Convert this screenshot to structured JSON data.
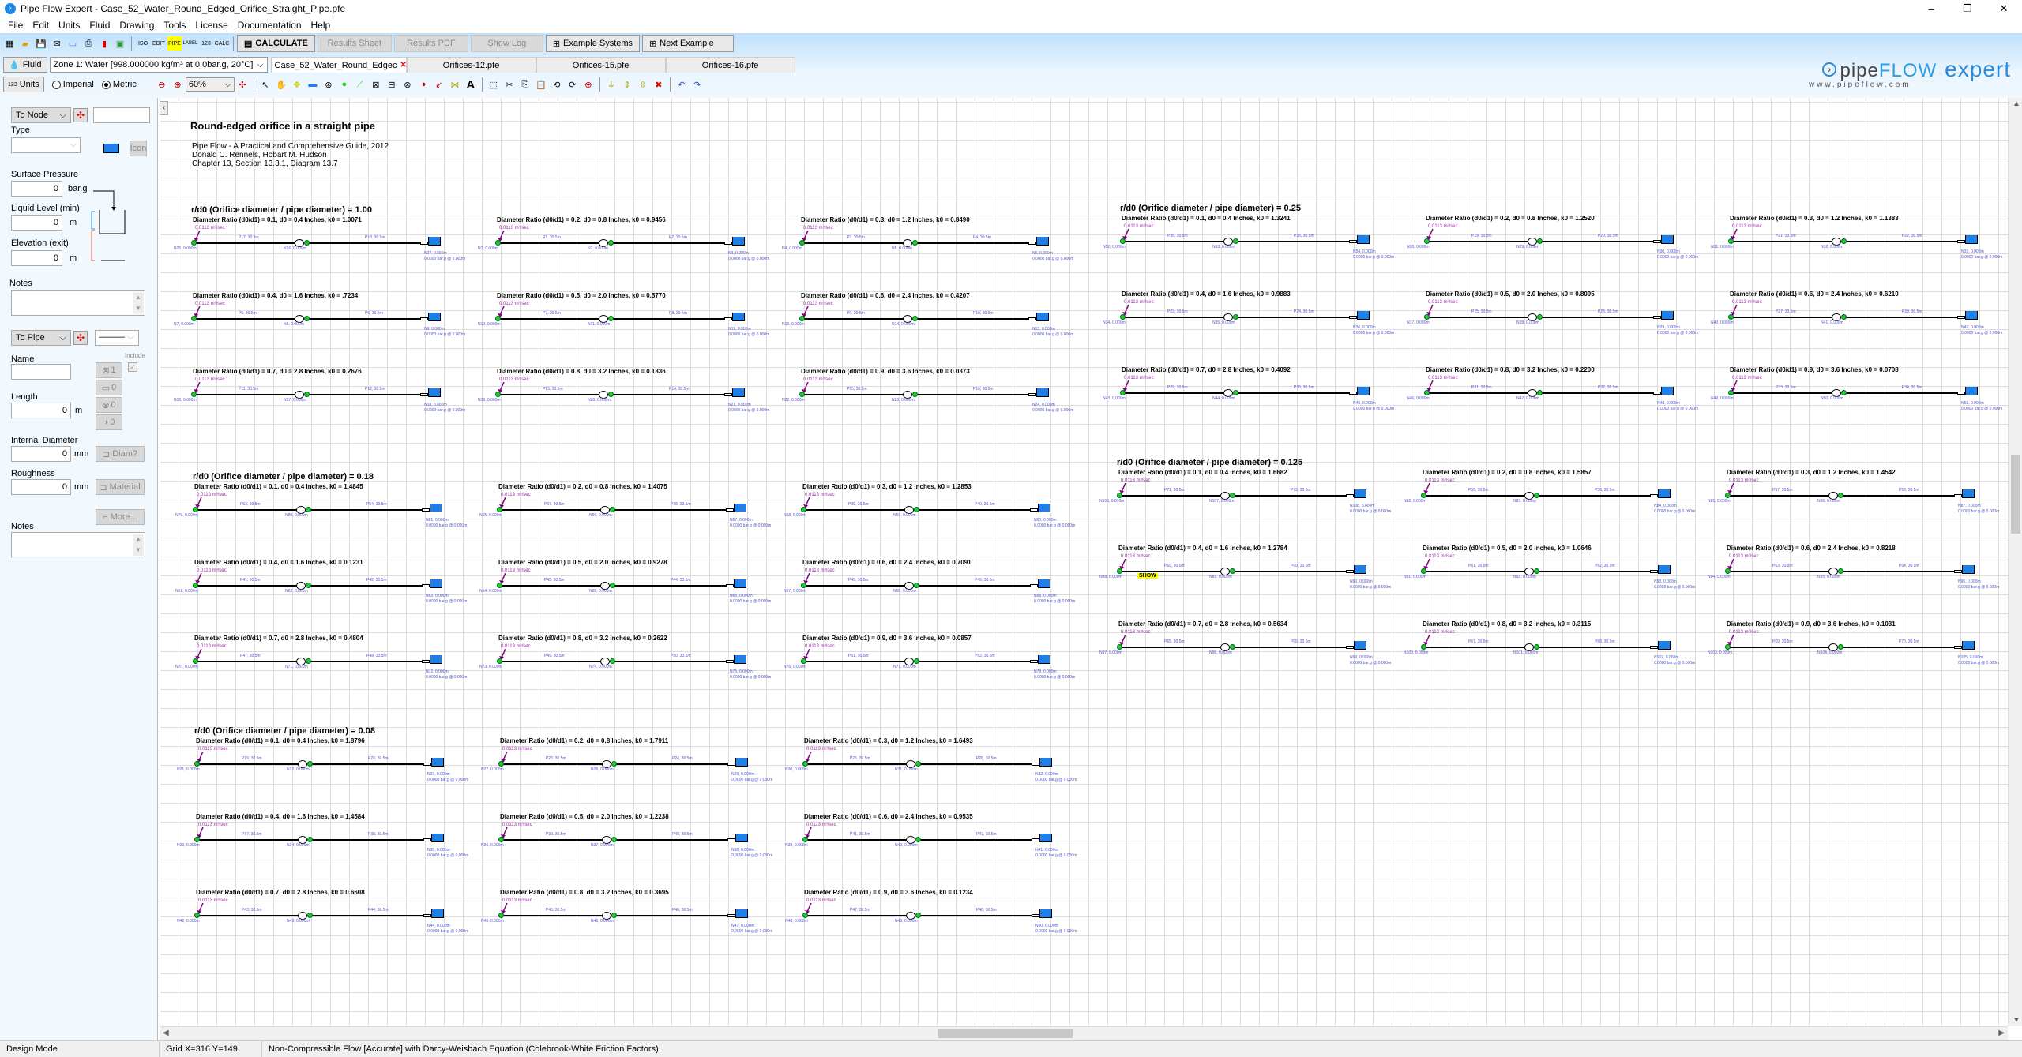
{
  "window": {
    "title": "Pipe Flow Expert - Case_52_Water_Round_Edged_Orifice_Straight_Pipe.pfe",
    "minimize": "–",
    "maximize": "❐",
    "close": "✕"
  },
  "menu": [
    "File",
    "Edit",
    "Units",
    "Fluid",
    "Drawing",
    "Tools",
    "License",
    "Documentation",
    "Help"
  ],
  "toolbar": {
    "icons_left": [
      "new-grid-icon",
      "open-folder-icon",
      "save-icon",
      "email-icon",
      "export-icon",
      "print-icon",
      "pdf-icon",
      "image-icon"
    ],
    "icons_mid": [
      "ISO",
      "EDIT",
      "PIPE",
      "LABEL",
      "123",
      "CALC"
    ],
    "calculate": "CALCULATE",
    "results_sheet": "Results Sheet",
    "results_pdf": "Results PDF",
    "show_log": "Show Log",
    "example_systems": "Example Systems",
    "next_example": "Next Example"
  },
  "fluid": {
    "button": "Fluid",
    "zone": "Zone 1: Water [998.000000 kg/m³ at 0.0bar.g, 20°C]"
  },
  "tabs": [
    {
      "label": "Case_52_Water_Round_Edgec",
      "active": true
    },
    {
      "label": "Orifices-12.pfe",
      "active": false
    },
    {
      "label": "Orifices-15.pfe",
      "active": false
    },
    {
      "label": "Orifices-16.pfe",
      "active": false
    }
  ],
  "units": {
    "button": "Units",
    "imperial": "Imperial",
    "metric": "Metric",
    "selected": "Metric"
  },
  "zoom_level": "60%",
  "logo": {
    "pipe": "pipe",
    "flow": "FLOW",
    "expert": "expert",
    "url": "www.pipeflow.com"
  },
  "node_panel": {
    "to_node": "To Node",
    "node_name": "",
    "type_label": "Type",
    "type_value": "",
    "icon_button": "Icon",
    "surface_pressure_label": "Surface Pressure",
    "surface_pressure": "0",
    "surface_pressure_unit": "bar.g",
    "liquid_level_label": "Liquid Level (min)",
    "liquid_level": "0",
    "liquid_level_unit": "m",
    "elevation_label": "Elevation (exit)",
    "elevation": "0",
    "elevation_unit": "m",
    "notes_label": "Notes"
  },
  "pipe_panel": {
    "to_pipe": "To Pipe",
    "name_label": "Name",
    "name": "",
    "include_label": "Include",
    "fittings_count": "1",
    "component_count": "0",
    "valve_count": "0",
    "pump_count": "0",
    "length_label": "Length",
    "length": "0",
    "length_unit": "m",
    "diameter_label": "Internal Diameter",
    "diameter": "0",
    "diameter_unit": "mm",
    "diam_button": "Diam?",
    "roughness_label": "Roughness",
    "roughness": "0",
    "roughness_unit": "mm",
    "material_button": "Material",
    "more_button": "More...",
    "notes_label": "Notes"
  },
  "drawing": {
    "title": "Round-edged orifice in a straight pipe",
    "reference": [
      "Pipe Flow - A Practical and Comprehensive Guide, 2012",
      "Donald C. Rennels, Hobart M. Hudson",
      "Chapter 13, Section 13.3.1, Diagram 13.7"
    ],
    "flow_label": "0.0113 m³/sec",
    "pipe_length": "30.5m",
    "node_elev": "0.000m",
    "tank_pressure": "0.0000 bar.g @ 0.000m",
    "show_label": "SHOW",
    "sections": [
      {
        "heading": "r/d0 (Orifice diameter / pipe diameter) = 1.00",
        "items": [
          {
            "caption": "Diameter Ratio (d0/d1) = 0.1, d0 = 0.4 Inches, k0 = 1.0071",
            "p1": "P17",
            "p2": "P18",
            "n1": "N25",
            "n2": "N26",
            "n3": "N27"
          },
          {
            "caption": "Diameter Ratio (d0/d1) = 0.2, d0 = 0.8 Inches, k0 = 0.9456",
            "p1": "P1",
            "p2": "P2",
            "n1": "N1",
            "n2": "N2",
            "n3": "N3"
          },
          {
            "caption": "Diameter Ratio (d0/d1) = 0.3, d0 = 1.2 Inches, k0 = 0.8490",
            "p1": "P3",
            "p2": "P4",
            "n1": "N4",
            "n2": "N5",
            "n3": "N6"
          },
          {
            "caption": "Diameter Ratio (d0/d1) = 0.4, d0 = 1.6 Inches, k0 = .7234",
            "p1": "P5",
            "p2": "P6",
            "n1": "N7",
            "n2": "N8",
            "n3": "N9"
          },
          {
            "caption": "Diameter Ratio (d0/d1) = 0.5, d0 = 2.0 Inches, k0 = 0.5770",
            "p1": "P7",
            "p2": "P8",
            "n1": "N10",
            "n2": "N11",
            "n3": "N12"
          },
          {
            "caption": "Diameter Ratio (d0/d1) = 0.6, d0 = 2.4 Inches, k0 = 0.4207",
            "p1": "P9",
            "p2": "P10",
            "n1": "N13",
            "n2": "N14",
            "n3": "N15"
          },
          {
            "caption": "Diameter Ratio (d0/d1) = 0.7, d0 = 2.8 Inches, k0 = 0.2676",
            "p1": "P11",
            "p2": "P12",
            "n1": "N16",
            "n2": "N17",
            "n3": "N18"
          },
          {
            "caption": "Diameter Ratio (d0/d1) = 0.8, d0 = 3.2 Inches, k0 = 0.1336",
            "p1": "P13",
            "p2": "P14",
            "n1": "N19",
            "n2": "N20",
            "n3": "N21"
          },
          {
            "caption": "Diameter Ratio (d0/d1) = 0.9, d0 = 3.6 Inches, k0 = 0.0373",
            "p1": "P15",
            "p2": "P16",
            "n1": "N22",
            "n2": "N23",
            "n3": "N24"
          }
        ]
      },
      {
        "heading": "r/d0 (Orifice diameter / pipe diameter) = 0.25",
        "items": [
          {
            "caption": "Diameter Ratio (d0/d1) = 0.1, d0 = 0.4 Inches, k0 = 1.3241",
            "p1": "P35",
            "p2": "P36",
            "n1": "N52",
            "n2": "N53",
            "n3": "N54"
          },
          {
            "caption": "Diameter Ratio (d0/d1) = 0.2, d0 = 0.8 Inches, k0 = 1.2520",
            "p1": "P19",
            "p2": "P20",
            "n1": "N28",
            "n2": "N29",
            "n3": "N30"
          },
          {
            "caption": "Diameter Ratio (d0/d1) = 0.3, d0 = 1.2 Inches, k0 = 1.1383",
            "p1": "P21",
            "p2": "P22",
            "n1": "N31",
            "n2": "N32",
            "n3": "N33"
          },
          {
            "caption": "Diameter Ratio (d0/d1) = 0.4, d0 = 1.6 Inches, k0 = 0.9883",
            "p1": "P23",
            "p2": "P24",
            "n1": "N34",
            "n2": "N35",
            "n3": "N36"
          },
          {
            "caption": "Diameter Ratio (d0/d1) = 0.5, d0 = 2.0 Inches, k0 = 0.8095",
            "p1": "P25",
            "p2": "P26",
            "n1": "N37",
            "n2": "N38",
            "n3": "N39"
          },
          {
            "caption": "Diameter Ratio (d0/d1) = 0.6, d0 = 2.4 Inches, k0 = 0.6210",
            "p1": "P27",
            "p2": "P28",
            "n1": "N40",
            "n2": "N41",
            "n3": "N42"
          },
          {
            "caption": "Diameter Ratio (d0/d1) = 0.7, d0 = 2.8 Inches, k0 = 0.4092",
            "p1": "P29",
            "p2": "P30",
            "n1": "N43",
            "n2": "N44",
            "n3": "N45"
          },
          {
            "caption": "Diameter Ratio (d0/d1) = 0.8, d0 = 3.2 Inches, k0 = 0.2200",
            "p1": "P31",
            "p2": "P32",
            "n1": "N46",
            "n2": "N47",
            "n3": "N48"
          },
          {
            "caption": "Diameter Ratio (d0/d1) = 0.9, d0 = 3.6 Inches, k0 = 0.0708",
            "p1": "P33",
            "p2": "P34",
            "n1": "N49",
            "n2": "N50",
            "n3": "N51"
          }
        ]
      },
      {
        "heading": "r/d0 (Orifice diameter / pipe diameter) = 0.18",
        "items": [
          {
            "caption": "Diameter Ratio (d0/d1) = 0.1, d0 = 0.4 Inches, k0 = 1.4845",
            "p1": "P53",
            "p2": "P54",
            "n1": "N79",
            "n2": "N80",
            "n3": "N81"
          },
          {
            "caption": "Diameter Ratio (d0/d1) = 0.2, d0 = 0.8 Inches, k0 = 1.4075",
            "p1": "P37",
            "p2": "P38",
            "n1": "N55",
            "n2": "N56",
            "n3": "N57"
          },
          {
            "caption": "Diameter Ratio (d0/d1) = 0.3, d0 = 1.2 Inches, k0 = 1.2853",
            "p1": "P39",
            "p2": "P40",
            "n1": "N58",
            "n2": "N59",
            "n3": "N60"
          },
          {
            "caption": "Diameter Ratio (d0/d1) = 0.4, d0 = 1.6 Inches, k0 = 0.1231",
            "p1": "P41",
            "p2": "P42",
            "n1": "N61",
            "n2": "N62",
            "n3": "N63"
          },
          {
            "caption": "Diameter Ratio (d0/d1) = 0.5, d0 = 2.0 Inches, k0 = 0.9278",
            "p1": "P43",
            "p2": "P44",
            "n1": "N64",
            "n2": "N65",
            "n3": "N66"
          },
          {
            "caption": "Diameter Ratio (d0/d1) = 0.6, d0 = 2.4 Inches, k0 = 0.7091",
            "p1": "P45",
            "p2": "P46",
            "n1": "N67",
            "n2": "N68",
            "n3": "N69"
          },
          {
            "caption": "Diameter Ratio (d0/d1) = 0.7, d0 = 2.8 Inches, k0 = 0.4804",
            "p1": "P47",
            "p2": "P48",
            "n1": "N70",
            "n2": "N71",
            "n3": "N72"
          },
          {
            "caption": "Diameter Ratio (d0/d1) = 0.8, d0 = 3.2 Inches, k0 = 0.2622",
            "p1": "P49",
            "p2": "P50",
            "n1": "N73",
            "n2": "N74",
            "n3": "N75"
          },
          {
            "caption": "Diameter Ratio (d0/d1) = 0.9, d0 = 3.6 Inches, k0 = 0.0857",
            "p1": "P51",
            "p2": "P52",
            "n1": "N76",
            "n2": "N77",
            "n3": "N78"
          }
        ]
      },
      {
        "heading": "r/d0 (Orifice diameter / pipe diameter) = 0.125",
        "items": [
          {
            "caption": "Diameter Ratio (d0/d1) = 0.1, d0 = 0.4 Inches, k0 = 1.6682",
            "p1": "P71",
            "p2": "P72",
            "n1": "N106",
            "n2": "N107",
            "n3": "N108"
          },
          {
            "caption": "Diameter Ratio (d0/d1) = 0.2, d0 = 0.8 Inches, k0 = 1.5857",
            "p1": "P55",
            "p2": "P56",
            "n1": "N82",
            "n2": "N83",
            "n3": "N84"
          },
          {
            "caption": "Diameter Ratio (d0/d1) = 0.3, d0 = 1.2 Inches, k0 = 1.4542",
            "p1": "P57",
            "p2": "P58",
            "n1": "N85",
            "n2": "N86",
            "n3": "N87"
          },
          {
            "caption": "Diameter Ratio (d0/d1) = 0.4, d0 = 1.6 Inches, k0 = 1.2784",
            "p1": "P59",
            "p2": "P60",
            "n1": "N88",
            "n2": "N89",
            "n3": "N90",
            "show": true
          },
          {
            "caption": "Diameter Ratio (d0/d1) = 0.5, d0 = 2.0 Inches, k0 = 1.0646",
            "p1": "P61",
            "p2": "P62",
            "n1": "N91",
            "n2": "N92",
            "n3": "N93"
          },
          {
            "caption": "Diameter Ratio (d0/d1) = 0.6, d0 = 2.4 Inches, k0 = 0.8218",
            "p1": "P63",
            "p2": "P64",
            "n1": "N94",
            "n2": "N95",
            "n3": "N96"
          },
          {
            "caption": "Diameter Ratio (d0/d1) = 0.7, d0 = 2.8 Inches, k0 = 0.5634",
            "p1": "P65",
            "p2": "P66",
            "n1": "N97",
            "n2": "N98",
            "n3": "N99"
          },
          {
            "caption": "Diameter Ratio (d0/d1) = 0.8, d0 = 3.2 Inches, k0 = 0.3115",
            "p1": "P67",
            "p2": "P68",
            "n1": "N100",
            "n2": "N101",
            "n3": "N102"
          },
          {
            "caption": "Diameter Ratio (d0/d1) = 0.9, d0 = 3.6 Inches, k0 = 0.1031",
            "p1": "P69",
            "p2": "P70",
            "n1": "N103",
            "n2": "N104",
            "n3": "N105"
          }
        ]
      },
      {
        "heading": "r/d0 (Orifice diameter / pipe diameter) = 0.08",
        "items": [
          {
            "caption": "Diameter Ratio (d0/d1) = 0.1, d0 = 0.4 Inches, k0 = 1.8796",
            "p1": "P19",
            "p2": "P20",
            "n1": "N21",
            "n2": "N22",
            "n3": "N23"
          },
          {
            "caption": "Diameter Ratio (d0/d1) = 0.2, d0 = 0.8 Inches, k0 = 1.7911",
            "p1": "P23",
            "p2": "P24",
            "n1": "N27",
            "n2": "N28",
            "n3": "N29"
          },
          {
            "caption": "Diameter Ratio (d0/d1) = 0.3, d0 = 1.2 Inches, k0 = 1.6493",
            "p1": "P25",
            "p2": "P26",
            "n1": "N30",
            "n2": "N31",
            "n3": "N32"
          },
          {
            "caption": "Diameter Ratio (d0/d1) = 0.4, d0 = 1.6 Inches, k0 = 1.4584",
            "p1": "P37",
            "p2": "P38",
            "n1": "N33",
            "n2": "N34",
            "n3": "N35"
          },
          {
            "caption": "Diameter Ratio (d0/d1) = 0.5, d0 = 2.0 Inches, k0 = 1.2238",
            "p1": "P39",
            "p2": "P40",
            "n1": "N36",
            "n2": "N37",
            "n3": "N38"
          },
          {
            "caption": "Diameter Ratio (d0/d1) = 0.6, d0 = 2.4 Inches, k0 = 0.9535",
            "p1": "P41",
            "p2": "P42",
            "n1": "N39",
            "n2": "N40",
            "n3": "N41"
          },
          {
            "caption": "Diameter Ratio (d0/d1) = 0.7, d0 = 2.8 Inches, k0 = 0.6608",
            "p1": "P43",
            "p2": "P44",
            "n1": "N42",
            "n2": "N43",
            "n3": "N44"
          },
          {
            "caption": "Diameter Ratio (d0/d1) = 0.8, d0 = 3.2 Inches, k0 = 0.3695",
            "p1": "P45",
            "p2": "P46",
            "n1": "N45",
            "n2": "N46",
            "n3": "N47"
          },
          {
            "caption": "Diameter Ratio (d0/d1) = 0.9, d0 = 3.6 Inches, k0 = 0.1234",
            "p1": "P47",
            "p2": "P48",
            "n1": "N48",
            "n2": "N49",
            "n3": "N50"
          }
        ]
      }
    ]
  },
  "status": {
    "mode": "Design Mode",
    "grid": "Grid  X=316  Y=149",
    "method": "Non-Compressible Flow [Accurate] with Darcy-Weisbach Equation (Colebrook-White Friction Factors)."
  }
}
